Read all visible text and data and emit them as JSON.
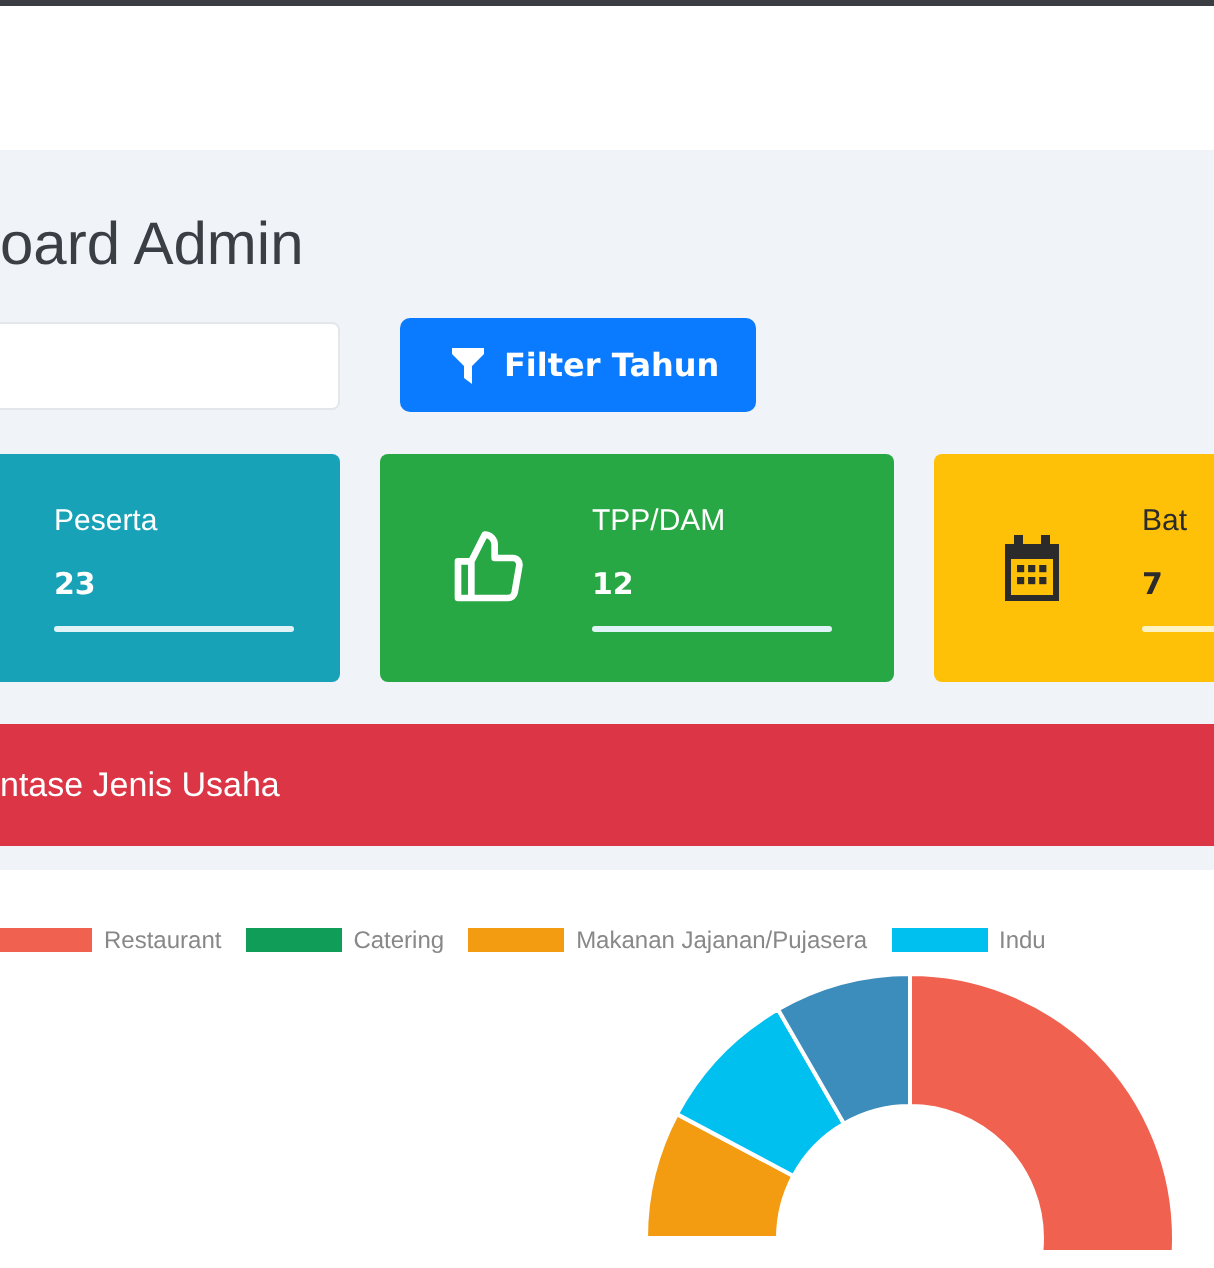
{
  "page_title": "oard Admin",
  "filter_button": {
    "label": "Filter Tahun"
  },
  "cards": [
    {
      "label": "Peserta",
      "value": "23",
      "color": "#17a2b8"
    },
    {
      "label": "TPP/DAM",
      "value": "12",
      "color": "#28a745"
    },
    {
      "label": "Bat",
      "value": "7",
      "color": "#ffc107"
    }
  ],
  "section_header": {
    "title": "ntase Jenis Usaha"
  },
  "legend": [
    {
      "label": "Restaurant",
      "color": "#f1614f"
    },
    {
      "label": "Catering",
      "color": "#0f9d58"
    },
    {
      "label": "Makanan Jajanan/Pujasera",
      "color": "#f39c12"
    },
    {
      "label": "Indu",
      "color": "#00c0ef"
    }
  ]
}
